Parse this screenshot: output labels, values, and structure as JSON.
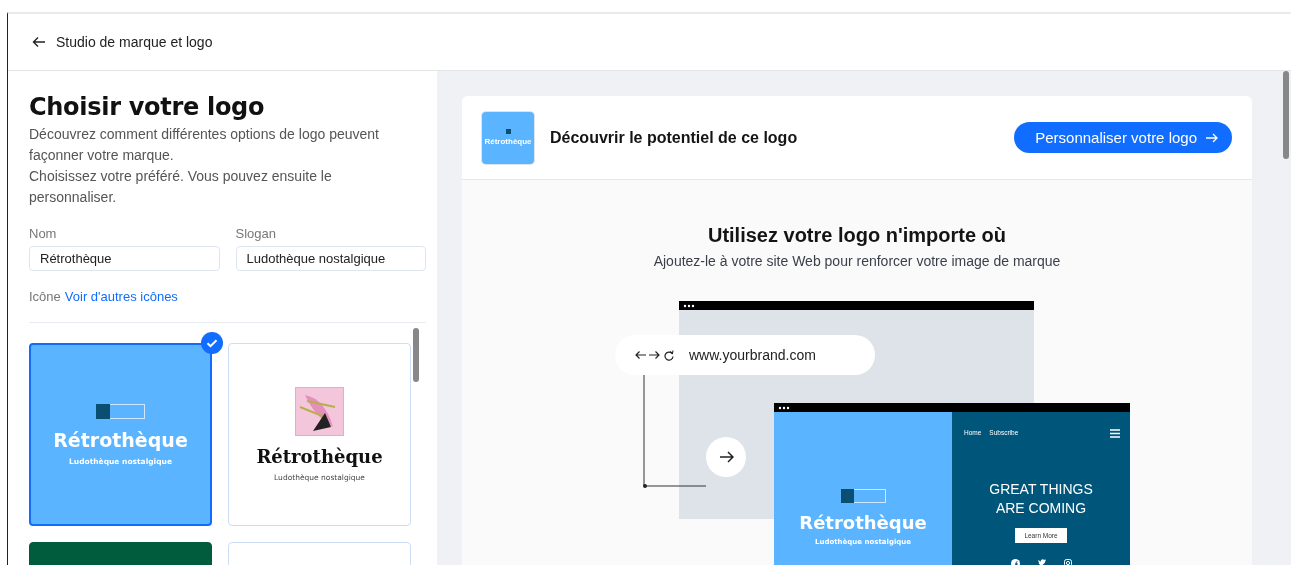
{
  "header": {
    "back_label": "Studio de marque et logo"
  },
  "left": {
    "title": "Choisir votre logo",
    "description": [
      "Découvrez comment différentes options de logo peuvent façonner votre marque.",
      "Choisissez votre préféré. Vous pouvez ensuite le personnaliser."
    ],
    "fields": [
      {
        "label": "Nom",
        "value": "Rétrothèque"
      },
      {
        "label": "Slogan",
        "value": "Ludothèque nostalgique"
      }
    ],
    "icon_label": "Icône",
    "icon_link": "Voir d'autres icônes",
    "logos": [
      {
        "kind": "blue",
        "name": "Rétrothèque",
        "slogan": "Ludothèque nostalgique",
        "selected": true
      },
      {
        "kind": "serif",
        "name": "Rétrothèque",
        "slogan": "Ludothèque nostalgique",
        "selected": false
      },
      {
        "kind": "green",
        "selected": false
      },
      {
        "kind": "white",
        "selected": false
      }
    ]
  },
  "preview": {
    "thumbnail_name": "Rétrothèque",
    "title": "Découvrir le potentiel de ce logo",
    "button": "Personnaliser votre logo",
    "heading": "Utilisez votre logo n'importe où",
    "subheading": "Ajoutez-le à votre site Web pour renforcer votre image de marque",
    "url": "www.yourbrand.com",
    "site": {
      "name": "Rétrothèque",
      "slogan": "Ludothèque nostalgique",
      "nav": [
        "Home",
        "Subscribe"
      ],
      "headline": "GREAT THINGS ARE COMING",
      "cta": "Learn More"
    }
  }
}
